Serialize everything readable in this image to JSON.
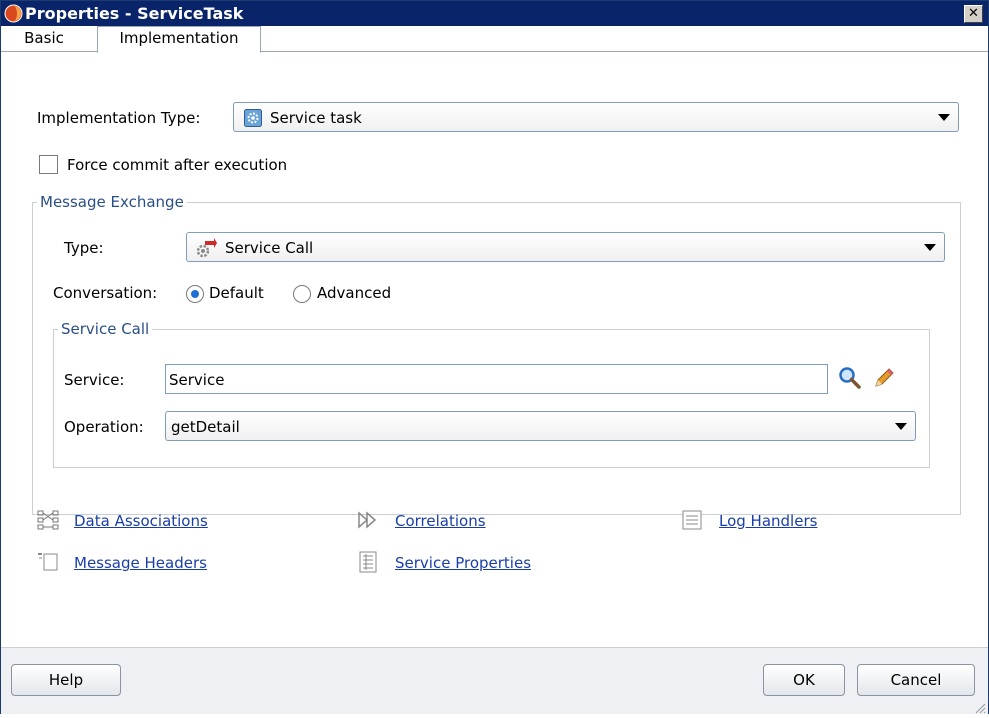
{
  "window": {
    "title": "Properties - ServiceTask",
    "close_label": "✕"
  },
  "tabs": [
    {
      "label": "Basic"
    },
    {
      "label": "Implementation"
    }
  ],
  "implementation_type": {
    "label": "Implementation Type:",
    "value": "Service task"
  },
  "force_commit": {
    "label": "Force commit after execution",
    "checked": false
  },
  "message_exchange": {
    "legend": "Message Exchange",
    "type_label": "Type:",
    "type_value": "Service Call",
    "conversation_label": "Conversation:",
    "conversation_options": [
      {
        "label": "Default",
        "selected": true
      },
      {
        "label": "Advanced",
        "selected": false
      }
    ]
  },
  "service_call": {
    "legend": "Service Call",
    "service_label": "Service:",
    "service_value": "Service",
    "operation_label": "Operation:",
    "operation_value": "getDetail"
  },
  "links": {
    "data_associations": "Data Associations",
    "correlations": "Correlations",
    "log_handlers": "Log Handlers",
    "message_headers": "Message Headers",
    "service_properties": "Service Properties"
  },
  "buttons": {
    "help": "Help",
    "ok": "OK",
    "cancel": "Cancel"
  },
  "colors": {
    "titlebar": "#0a246a",
    "link": "#1a3ea8",
    "group_legend": "#2a4f87",
    "radio_selected": "#1f6fd6"
  },
  "icons": [
    "app-logo-icon",
    "close-icon",
    "service-task-icon",
    "service-call-icon",
    "search-icon",
    "edit-icon",
    "data-associations-icon",
    "correlations-icon",
    "log-handlers-icon",
    "message-headers-icon",
    "service-properties-icon"
  ]
}
